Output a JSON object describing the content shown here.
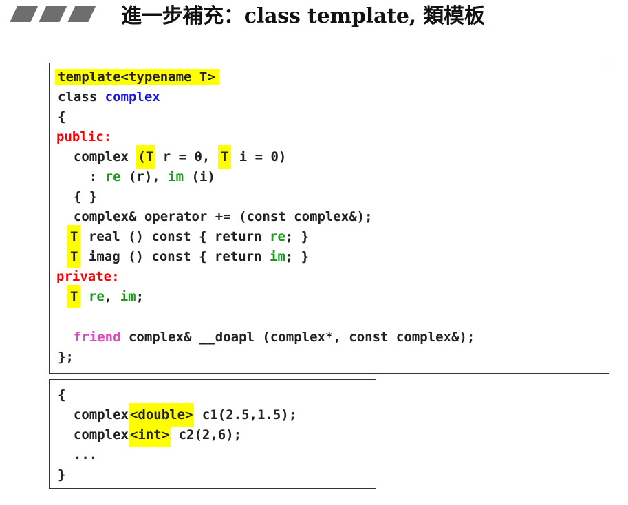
{
  "slide": {
    "title": "進一步補充：class template, 類模板"
  },
  "colors": {
    "highlight": "#ffff00",
    "access_specifier": "#ff0000",
    "class_name": "#1a1ad6",
    "member_name": "#1c9a1c",
    "friend_keyword": "#e048c0"
  },
  "code_main": {
    "l1": "template<typename T>",
    "l2a": "class ",
    "l2b": "complex",
    "l3": "{",
    "l4": "public:",
    "l5a": "  complex ",
    "l5b": "(T",
    "l5c": " r = 0, ",
    "l5d": "T",
    "l5e": " i = 0)",
    "l6a": "    : ",
    "l6b": "re",
    "l6c": " (r), ",
    "l6d": "im",
    "l6e": " (i)",
    "l7": "  { }",
    "l8": "  complex& operator += (const complex&);",
    "l9a": "T",
    "l9b": " real () const { return ",
    "l9c": "re",
    "l9d": "; }",
    "l10a": "T",
    "l10b": " imag () const { return ",
    "l10c": "im",
    "l10d": "; }",
    "l11": "private:",
    "l12a": "T",
    "l12b": " ",
    "l12c": "re",
    "l12d": ", ",
    "l12e": "im",
    "l12f": ";",
    "l14a": "  ",
    "l14b": "friend",
    "l14c": " complex& __doapl (complex*, const complex&);",
    "l15": "};"
  },
  "code_usage": {
    "l1": "{",
    "l2a": "  complex",
    "l2b": "<double>",
    "l2c": " c1(2.5,1.5);",
    "l3a": "  complex",
    "l3b": "<int>",
    "l3c": " c2(2,6);",
    "l4": "  ...",
    "l5": "}"
  }
}
